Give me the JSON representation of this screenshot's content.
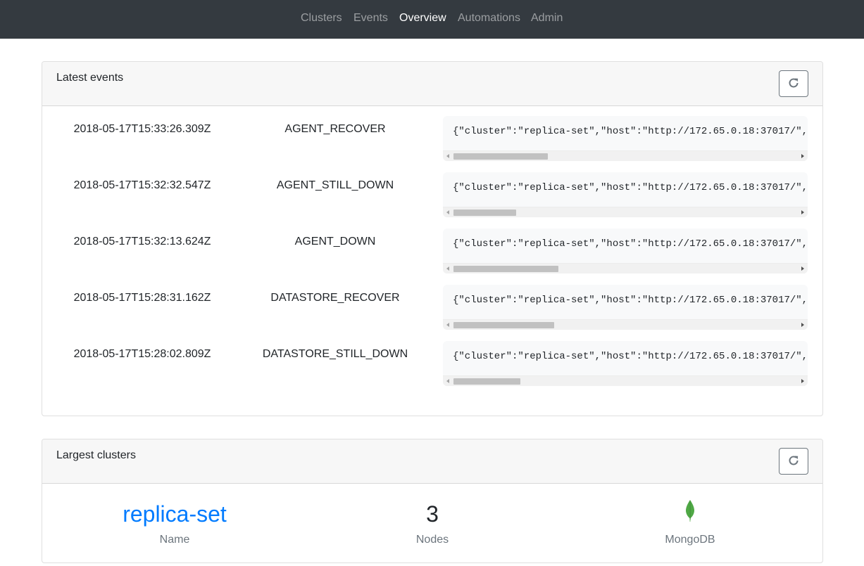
{
  "navbar": {
    "items": [
      {
        "label": "Clusters",
        "active": false
      },
      {
        "label": "Events",
        "active": false
      },
      {
        "label": "Overview",
        "active": true
      },
      {
        "label": "Automations",
        "active": false
      },
      {
        "label": "Admin",
        "active": false
      }
    ]
  },
  "latest_events": {
    "title": "Latest events",
    "refresh_icon": "refresh-icon",
    "events": [
      {
        "timestamp": "2018-05-17T15:33:26.309Z",
        "type": "AGENT_RECOVER",
        "payload": "{\"cluster\":\"replica-set\",\"host\":\"http://172.65.0.18:37017/\",",
        "scroll_position": 0.26
      },
      {
        "timestamp": "2018-05-17T15:32:32.547Z",
        "type": "AGENT_STILL_DOWN",
        "payload": "{\"cluster\":\"replica-set\",\"host\":\"http://172.65.0.18:37017/\",",
        "scroll_position": 0.18
      },
      {
        "timestamp": "2018-05-17T15:32:13.624Z",
        "type": "AGENT_DOWN",
        "payload": "{\"cluster\":\"replica-set\",\"host\":\"http://172.65.0.18:37017/\",",
        "scroll_position": 0.3
      },
      {
        "timestamp": "2018-05-17T15:28:31.162Z",
        "type": "DATASTORE_RECOVER",
        "payload": "{\"cluster\":\"replica-set\",\"host\":\"http://172.65.0.18:37017/\",",
        "scroll_position": 0.29
      },
      {
        "timestamp": "2018-05-17T15:28:02.809Z",
        "type": "DATASTORE_STILL_DOWN",
        "payload": "{\"cluster\":\"replica-set\",\"host\":\"http://172.65.0.18:37017/\",",
        "scroll_position": 0.19
      }
    ]
  },
  "largest_clusters": {
    "title": "Largest clusters",
    "refresh_icon": "refresh-icon",
    "clusters": [
      {
        "name": "replica-set",
        "name_label": "Name",
        "nodes": "3",
        "nodes_label": "Nodes",
        "datastore": "MongoDB",
        "datastore_icon": "mongodb-leaf-icon"
      }
    ]
  },
  "colors": {
    "navbar_bg": "#343a40",
    "link": "#007bff",
    "muted": "#6c757d",
    "mongodb_green": "#4fa845"
  }
}
